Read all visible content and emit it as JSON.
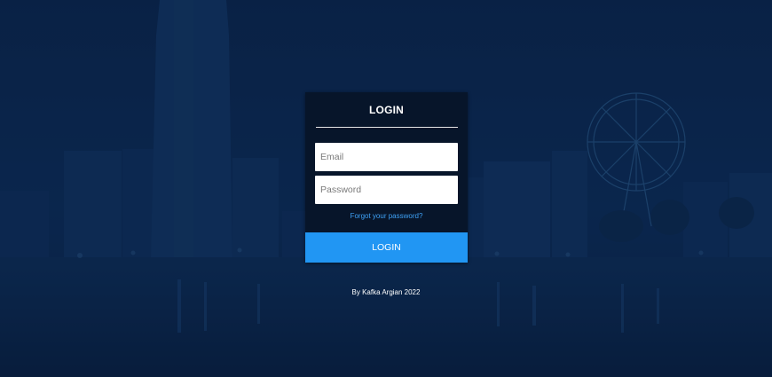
{
  "login": {
    "title": "LOGIN",
    "email_placeholder": "Email",
    "password_placeholder": "Password",
    "forgot_password_label": "Forgot your password?",
    "submit_label": "LOGIN"
  },
  "footer": {
    "credit": "By Kafka Argian 2022"
  },
  "colors": {
    "overlay": "#0b2547",
    "card": "#07152a",
    "accent": "#2196f3",
    "link": "#3fa2f7"
  },
  "background": {
    "scene": "city-night-skyline-with-ferris-wheel"
  }
}
